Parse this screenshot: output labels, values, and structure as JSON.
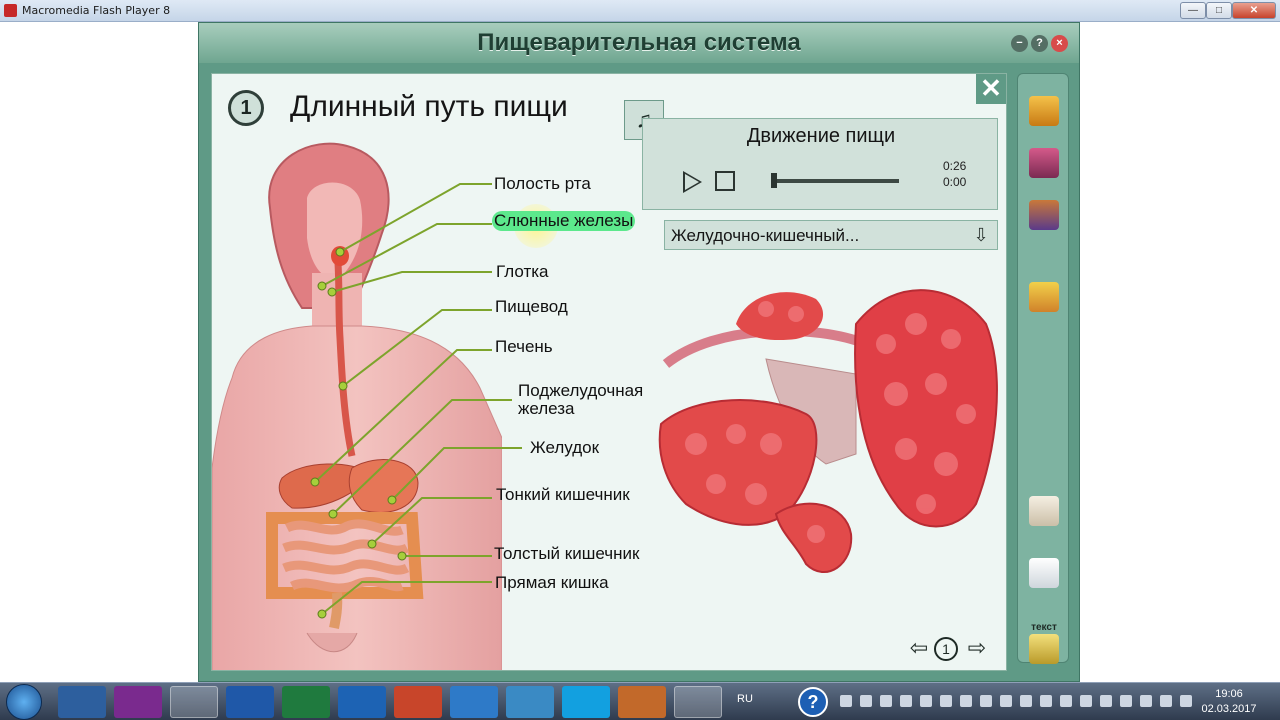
{
  "window": {
    "title": "Macromedia Flash Player 8"
  },
  "app": {
    "title": "Пищеварительная система",
    "lesson_number": "1",
    "lesson_title": "Длинный путь пищи",
    "close_label": "✕"
  },
  "organs": [
    "Полость рта",
    "Слюнные железы",
    "Глотка",
    "Пищевод",
    "Печень",
    "Поджелудочная",
    "железа",
    "Желудок",
    "Тонкий кишечник",
    "Толстый кишечник",
    "Прямая кишка"
  ],
  "player": {
    "title": "Движение пищи",
    "time_total": "0:26",
    "time_current": "0:00",
    "progress": 0
  },
  "dropdown": {
    "selected": "Желудочно-кишечный..."
  },
  "pager": {
    "current": "1",
    "prev": "⇦",
    "next": "⇨"
  },
  "sidebar": {
    "text_button": "текст"
  },
  "taskbar": {
    "language": "RU",
    "help": "?",
    "time": "19:06",
    "date": "02.03.2017"
  }
}
